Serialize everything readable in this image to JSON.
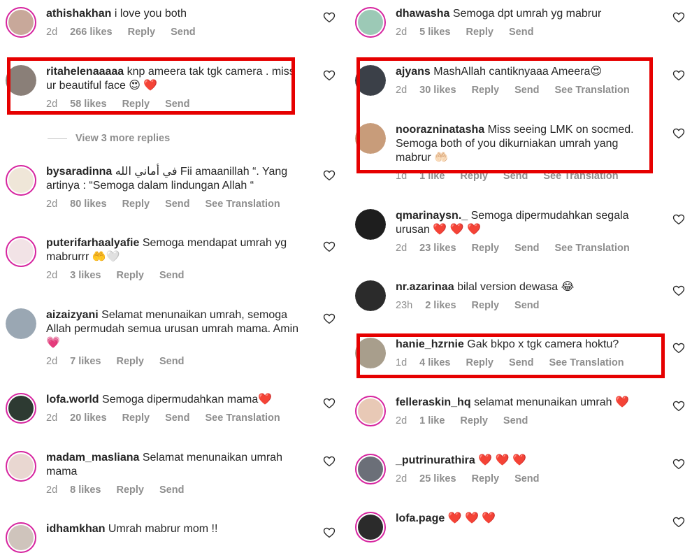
{
  "colors": {
    "highlight": "#e60000",
    "meta": "#8e8e8e",
    "ring": "#d6249f"
  },
  "view_more": "View 3 more replies",
  "left_column": [
    {
      "user": "athishakhan",
      "text": "i love you both",
      "time": "2d",
      "likes": "266 likes",
      "reply": "Reply",
      "send": "Send",
      "translate": ""
    },
    {
      "user": "ritahelenaaaaa",
      "text": "knp ameera tak tgk camera . miss ur beautiful face 😍 ❤️",
      "time": "2d",
      "likes": "58 likes",
      "reply": "Reply",
      "send": "Send",
      "translate": ""
    },
    {
      "user": "bysaradinna",
      "text": "في أماني الله Fii amaanillah “. Yang artinya : “Semoga dalam lindungan Allah “",
      "time": "2d",
      "likes": "80 likes",
      "reply": "Reply",
      "send": "Send",
      "translate": "See Translation"
    },
    {
      "user": "puterifarhaalyafie",
      "text": "Semoga mendapat umrah yg mabrurrr 🤲🤍",
      "time": "2d",
      "likes": "3 likes",
      "reply": "Reply",
      "send": "Send",
      "translate": ""
    },
    {
      "user": "aizaizyani",
      "text": "Selamat menunaikan umrah, semoga Allah permudah semua urusan umrah mama. Amin💗",
      "time": "2d",
      "likes": "7 likes",
      "reply": "Reply",
      "send": "Send",
      "translate": ""
    },
    {
      "user": "lofa.world",
      "text": "Semoga dipermudahkan mama❤️",
      "time": "2d",
      "likes": "20 likes",
      "reply": "Reply",
      "send": "Send",
      "translate": "See Translation"
    },
    {
      "user": "madam_masliana",
      "text": "Selamat menunaikan umrah mama",
      "time": "2d",
      "likes": "8 likes",
      "reply": "Reply",
      "send": "Send",
      "translate": ""
    },
    {
      "user": "idhamkhan",
      "text": "Umrah mabrur mom !!",
      "time": "",
      "likes": "",
      "reply": "",
      "send": "",
      "translate": ""
    }
  ],
  "right_column": [
    {
      "user": "dhawasha",
      "text": "Semoga dpt umrah yg mabrur",
      "time": "2d",
      "likes": "5 likes",
      "reply": "Reply",
      "send": "Send",
      "translate": ""
    },
    {
      "user": "ajyans",
      "text": "MashAllah cantiknyaaa Ameera😍",
      "time": "2d",
      "likes": "30 likes",
      "reply": "Reply",
      "send": "Send",
      "translate": "See Translation"
    },
    {
      "user": "noorazninatasha",
      "text": "Miss seeing LMK on socmed. Semoga both of you dikurniakan umrah yang mabrur 🤲🏻",
      "time": "1d",
      "likes": "1 like",
      "reply": "Reply",
      "send": "Send",
      "translate": "See Translation"
    },
    {
      "user": "qmarinaysn._",
      "text": "Semoga dipermudahkan segala urusan ❤️ ❤️ ❤️",
      "time": "2d",
      "likes": "23 likes",
      "reply": "Reply",
      "send": "Send",
      "translate": "See Translation"
    },
    {
      "user": "nr.azarinaa",
      "text": "bilal version dewasa 😂",
      "time": "23h",
      "likes": "2 likes",
      "reply": "Reply",
      "send": "Send",
      "translate": ""
    },
    {
      "user": "hanie_hzrnie",
      "text": "Gak bkpo x tgk camera hoktu?",
      "time": "1d",
      "likes": "4 likes",
      "reply": "Reply",
      "send": "Send",
      "translate": "See Translation"
    },
    {
      "user": "felleraskin_hq",
      "text": "selamat menunaikan umrah ❤️",
      "time": "2d",
      "likes": "1 like",
      "reply": "Reply",
      "send": "Send",
      "translate": ""
    },
    {
      "user": "_putrinurathira",
      "text": "❤️ ❤️ ❤️",
      "time": "2d",
      "likes": "25 likes",
      "reply": "Reply",
      "send": "Send",
      "translate": ""
    },
    {
      "user": "lofa.page",
      "text": "❤️ ❤️ ❤️",
      "time": "",
      "likes": "",
      "reply": "",
      "send": "",
      "translate": ""
    }
  ]
}
